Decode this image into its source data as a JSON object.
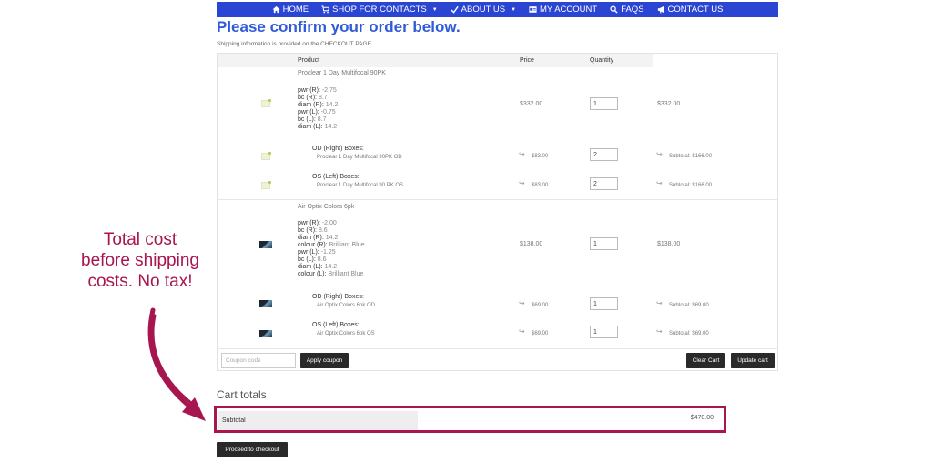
{
  "nav": {
    "home": "HOME",
    "shop": "SHOP FOR CONTACTS",
    "about": "ABOUT US",
    "account": "MY ACCOUNT",
    "faqs": "FAQS",
    "contact": "CONTACT US",
    "color": "#2b45d3"
  },
  "page": {
    "title": "Please confirm your order below.",
    "shipping_note": "Shipping information is provided on the CHECKOUT PAGE"
  },
  "table": {
    "headers": {
      "product": "Product",
      "price": "Price",
      "quantity": "Quantity"
    }
  },
  "items": [
    {
      "name": "Proclear 1 Day Multifocal 90PK",
      "specs": [
        {
          "k": "pwr (R):",
          "v": "-2.75"
        },
        {
          "k": "bc (R):",
          "v": "8.7"
        },
        {
          "k": "diam (R):",
          "v": "14.2"
        },
        {
          "k": "pwr (L):",
          "v": "-0.75"
        },
        {
          "k": "bc (L):",
          "v": "8.7"
        },
        {
          "k": "diam (L):",
          "v": "14.2"
        }
      ],
      "price": "$332.00",
      "qty": "1",
      "total": "$332.00",
      "od_label": "OD (Right) Boxes:",
      "od_name": "Proclear 1 Day Multifocal 90PK OD",
      "od_price": "$83.00",
      "od_qty": "2",
      "od_subtotal": "Subtotal: $166.00",
      "os_label": "OS (Left) Boxes:",
      "os_name": "Proclear 1 Day Multifocal 90 PK OS",
      "os_price": "$83.00",
      "os_qty": "2",
      "os_subtotal": "Subtotal: $166.00"
    },
    {
      "name": "Air Optix Colors 6pk",
      "specs": [
        {
          "k": "pwr (R):",
          "v": "-2.00"
        },
        {
          "k": "bc (R):",
          "v": "8.6"
        },
        {
          "k": "diam (R):",
          "v": "14.2"
        },
        {
          "k": "colour (R):",
          "v": "Brilliant Blue"
        },
        {
          "k": "pwr (L):",
          "v": "-1.25"
        },
        {
          "k": "bc (L):",
          "v": "8.6"
        },
        {
          "k": "diam (L):",
          "v": "14.2"
        },
        {
          "k": "colour (L):",
          "v": "Brilliant Blue"
        }
      ],
      "price": "$138.00",
      "qty": "1",
      "total": "$138.00",
      "od_label": "OD (Right) Boxes:",
      "od_name": "Air Optix Colors 6pk OD",
      "od_price": "$69.00",
      "od_qty": "1",
      "od_subtotal": "Subtotal: $69.00",
      "os_label": "OS (Left) Boxes:",
      "os_name": "Air Optix Colors 6pk OS",
      "os_price": "$69.00",
      "os_qty": "1",
      "os_subtotal": "Subtotal: $69.00"
    }
  ],
  "actions": {
    "coupon_placeholder": "Coupon code",
    "apply_coupon": "Apply coupon",
    "clear_cart": "Clear Cart",
    "update_cart": "Update cart"
  },
  "totals": {
    "title": "Cart totals",
    "subtotal_label": "Subtotal",
    "subtotal_value": "$470.00",
    "checkout": "Proceed to checkout",
    "highlight_color": "#a8164f"
  },
  "annotation": {
    "text": "Total cost\nbefore shipping\ncosts.  No tax!"
  },
  "icons": {
    "home": "home-icon",
    "shop": "cart-icon",
    "about": "check-icon",
    "account": "account-card-icon",
    "faqs": "search-icon",
    "contact": "megaphone-icon"
  }
}
